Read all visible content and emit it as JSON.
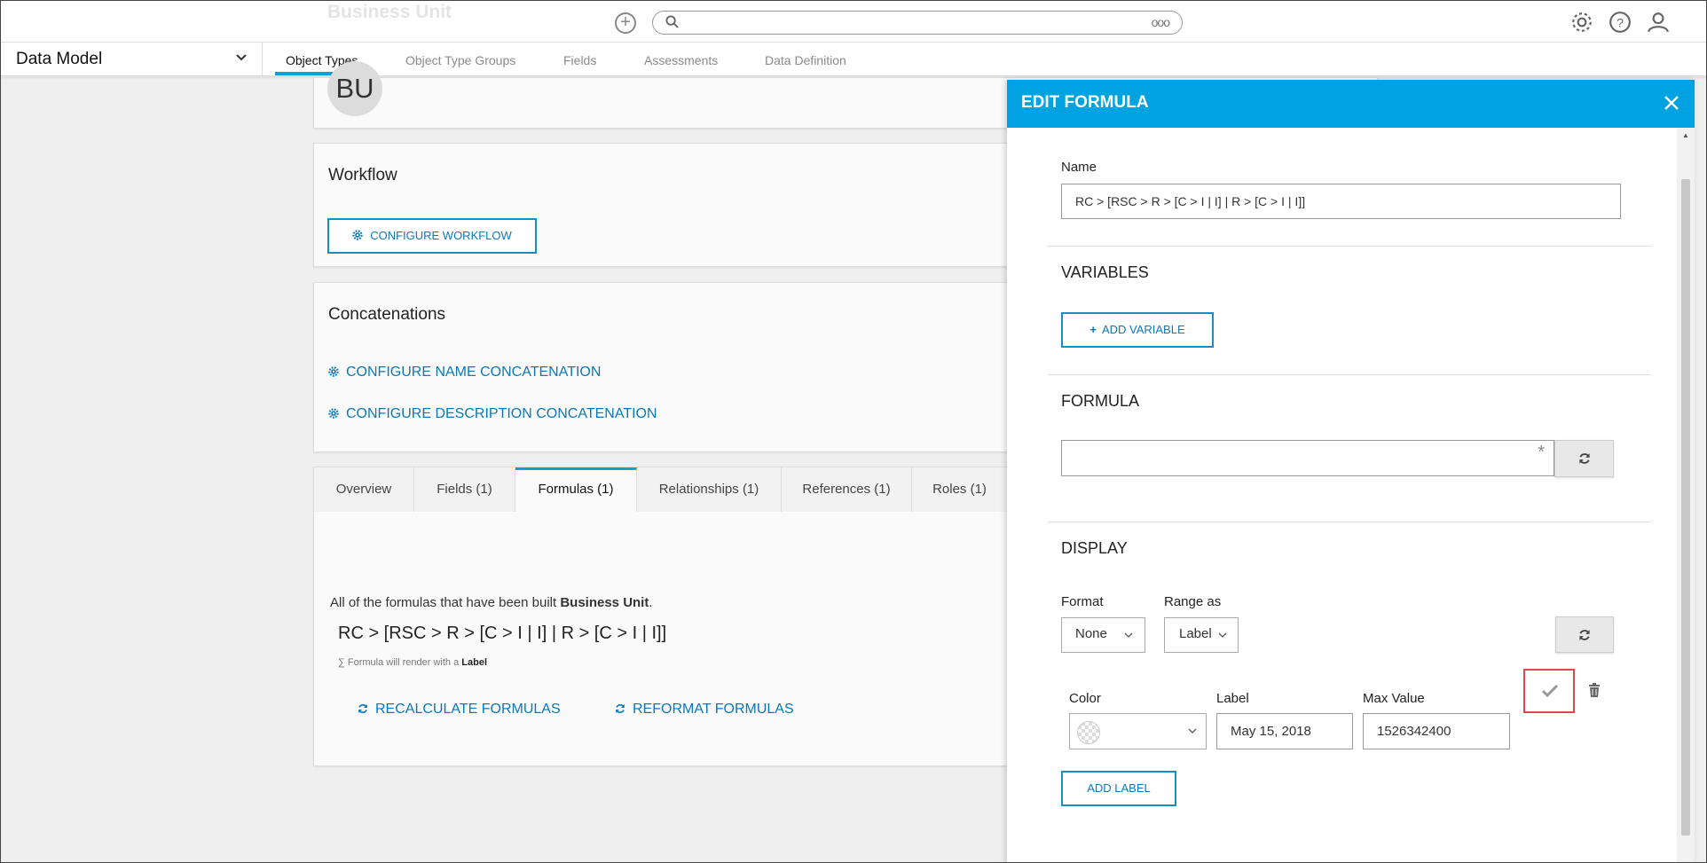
{
  "topbar": {
    "ghost_title": "Business Unit",
    "search_placeholder": "",
    "search_more": "ooo"
  },
  "nav": {
    "module": "Data Model",
    "tabs": [
      {
        "label": "Object Types",
        "active": true
      },
      {
        "label": "Object Type Groups",
        "active": false
      },
      {
        "label": "Fields",
        "active": false
      },
      {
        "label": "Assessments",
        "active": false
      },
      {
        "label": "Data Definition",
        "active": false
      }
    ]
  },
  "object": {
    "avatar_initials": "BU",
    "workflow_title": "Workflow",
    "configure_workflow": "CONFIGURE WORKFLOW",
    "concatenations_title": "Concatenations",
    "configure_name": "CONFIGURE NAME CONCATENATION",
    "configure_description": "CONFIGURE DESCRIPTION CONCATENATION"
  },
  "detail_tabs": [
    {
      "label": "Overview",
      "active": false
    },
    {
      "label": "Fields (1)",
      "active": false
    },
    {
      "label": "Formulas (1)",
      "active": true
    },
    {
      "label": "Relationships (1)",
      "active": false
    },
    {
      "label": "References (1)",
      "active": false
    },
    {
      "label": "Roles (1)",
      "active": false
    }
  ],
  "formulas": {
    "intro": "All of the formulas that have been built",
    "intro_bold": "Business Unit",
    "intro_end": ".",
    "formula_name": "RC > [RSC > R > [C > I | I] | R > [C > I | I]]",
    "render_note": "∑ Formula will render with a",
    "render_note_bold": "Label",
    "recalculate": "RECALCULATE FORMULAS",
    "reformat": "REFORMAT FORMULAS"
  },
  "panel": {
    "title": "EDIT FORMULA",
    "name_label": "Name",
    "name_value": "RC > [RSC > R > [C > I | I] | R > [C > I | I]]",
    "variables_title": "VARIABLES",
    "add_variable": "ADD VARIABLE",
    "formula_title": "FORMULA",
    "formula_value": "",
    "required_mark": "*",
    "display_title": "DISPLAY",
    "format_label": "Format",
    "format_value": "None",
    "range_label": "Range as",
    "range_value": "Label",
    "color_label": "Color",
    "label_label": "Label",
    "max_label": "Max Value",
    "label_value": "May 15, 2018",
    "max_value": "1526342400",
    "add_label": "ADD LABEL"
  },
  "colors": {
    "accent": "#00a3e0",
    "link": "#0b78b8",
    "highlight": "#d94a4a"
  }
}
